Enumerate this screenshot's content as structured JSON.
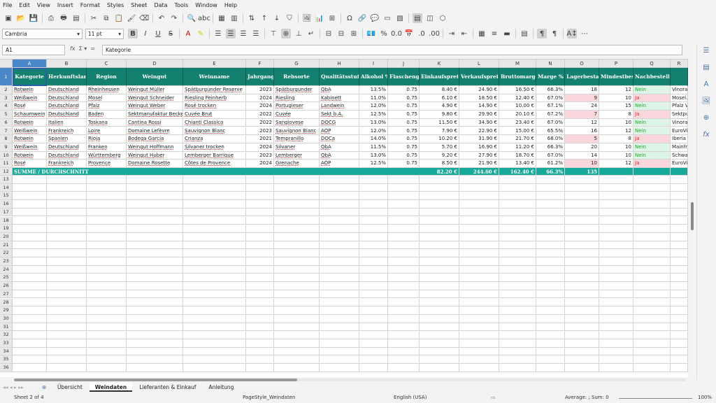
{
  "menu": [
    "File",
    "Edit",
    "View",
    "Insert",
    "Format",
    "Styles",
    "Sheet",
    "Data",
    "Tools",
    "Window",
    "Help"
  ],
  "toolbar": {
    "font_name": "Cambria",
    "font_size": "11 pt"
  },
  "formula": {
    "cell_ref": "A1",
    "content": "Kategorie"
  },
  "columns": [
    {
      "letter": "A",
      "w": 49,
      "sel": true
    },
    {
      "letter": "B",
      "w": 57
    },
    {
      "letter": "C",
      "w": 57
    },
    {
      "letter": "D",
      "w": 81
    },
    {
      "letter": "E",
      "w": 90
    },
    {
      "letter": "F",
      "w": 40
    },
    {
      "letter": "G",
      "w": 65
    },
    {
      "letter": "H",
      "w": 57
    },
    {
      "letter": "I",
      "w": 41
    },
    {
      "letter": "J",
      "w": 45
    },
    {
      "letter": "K",
      "w": 57
    },
    {
      "letter": "L",
      "w": 57
    },
    {
      "letter": "M",
      "w": 53
    },
    {
      "letter": "N",
      "w": 41
    },
    {
      "letter": "O",
      "w": 49
    },
    {
      "letter": "P",
      "w": 49
    },
    {
      "letter": "Q",
      "w": 53
    },
    {
      "letter": "R",
      "w": 25
    }
  ],
  "headers": [
    "Kategorie",
    "Herkunftsland",
    "Region",
    "Weingut",
    "Weinname",
    "Jahrgang",
    "Rebsorte",
    "Qualitätsstufe",
    "Alkohol %",
    "Flaschengröße",
    "Einkaufspreis",
    "Verkaufspreis",
    "Bruttomarge €",
    "Marge %",
    "Lagerbestand",
    "Mindestbestand",
    "Nachbestellen",
    ""
  ],
  "rows": [
    [
      "Rotwein",
      "Deutschland",
      "Rheinhessen",
      "Weingut Müller",
      "Spätburgunder Reserve",
      "2023",
      "Spätburgunder",
      "QbA",
      "13.5%",
      "0.75",
      "8.40 €",
      "24.90 €",
      "16.50 €",
      "66.3%",
      "18",
      "12",
      "Nein",
      "Vinorama"
    ],
    [
      "Weißwein",
      "Deutschland",
      "Mosel",
      "Weingut Schneider",
      "Riesling Feinherb",
      "2024",
      "Riesling",
      "Kabinett",
      "11.0%",
      "0.75",
      "6.10 €",
      "18.50 €",
      "12.40 €",
      "67.0%",
      "9",
      "10",
      "Ja",
      "Mosel..."
    ],
    [
      "Rosé",
      "Deutschland",
      "Pfalz",
      "Weingut Weber",
      "Rosé trocken",
      "2024",
      "Portugieser",
      "Landwein",
      "12.0%",
      "0.75",
      "4.90 €",
      "14.90 €",
      "10.00 €",
      "67.1%",
      "24",
      "15",
      "Nein",
      "Pfalz Vi"
    ],
    [
      "Schaumwein",
      "Deutschland",
      "Baden",
      "Sektmanufaktur Becker",
      "Cuvée Brut",
      "2022",
      "Cuvée",
      "Sekt b.A.",
      "12.5%",
      "0.75",
      "9.80 €",
      "29.90 €",
      "20.10 €",
      "67.2%",
      "7",
      "8",
      "Ja",
      "Sektpu"
    ],
    [
      "Rotwein",
      "Italien",
      "Toskana",
      "Cantina Rossi",
      "Chianti Classico",
      "2022",
      "Sangiovese",
      "DOCG",
      "13.0%",
      "0.75",
      "11.50 €",
      "34.90 €",
      "23.40 €",
      "67.0%",
      "12",
      "10",
      "Nein",
      "Vinorama"
    ],
    [
      "Weißwein",
      "Frankreich",
      "Loire",
      "Domaine Lefèvre",
      "Sauvignon Blanc",
      "2023",
      "Sauvignon Blanc",
      "AOP",
      "12.0%",
      "0.75",
      "7.90 €",
      "22.90 €",
      "15.00 €",
      "65.5%",
      "16",
      "12",
      "Nein",
      "EuroVi"
    ],
    [
      "Rotwein",
      "Spanien",
      "Rioja",
      "Bodega García",
      "Crianza",
      "2021",
      "Tempranillo",
      "DOCa",
      "14.0%",
      "0.75",
      "10.20 €",
      "31.90 €",
      "21.70 €",
      "68.0%",
      "5",
      "8",
      "Ja",
      "Iberia T"
    ],
    [
      "Weißwein",
      "Deutschland",
      "Franken",
      "Weingut Hoffmann",
      "Silvaner trocken",
      "2024",
      "Silvaner",
      "QbA",
      "11.5%",
      "0.75",
      "5.70 €",
      "16.90 €",
      "11.20 €",
      "66.3%",
      "20",
      "10",
      "Nein",
      "Mainfr"
    ],
    [
      "Rotwein",
      "Deutschland",
      "Württemberg",
      "Weingut Huber",
      "Lemberger Barrique",
      "2023",
      "Lemberger",
      "QbA",
      "13.0%",
      "0.75",
      "9.20 €",
      "27.90 €",
      "18.70 €",
      "67.0%",
      "14",
      "10",
      "Nein",
      "Schwa"
    ],
    [
      "Rosé",
      "Frankreich",
      "Provence",
      "Domaine Rosette",
      "Côtes de Provence",
      "2024",
      "Grenache",
      "AOP",
      "12.5%",
      "0.75",
      "8.50 €",
      "21.90 €",
      "13.40 €",
      "61.2%",
      "10",
      "12",
      "Ja",
      "EuroVi"
    ]
  ],
  "summary": {
    "label": "SUMME / DURCHSCHNITT",
    "k": "82.20 €",
    "l": "244.60 €",
    "m": "162.40 €",
    "n": "66.3%",
    "o": "135"
  },
  "sheets": [
    "Übersicht",
    "Weindaten",
    "Lieferanten & Einkauf",
    "Anleitung"
  ],
  "status": {
    "sheet": "Sheet 2 of 4",
    "style": "PageStyle_Weindaten",
    "lang": "English (USA)",
    "calc": "Average: ; Sum: 0",
    "zoom": "100%"
  },
  "colors": {
    "header": "#14806f",
    "summary": "#18a99a",
    "selection": "#4a86c8",
    "ja": "#dd2222",
    "nein": "#22aa22"
  }
}
